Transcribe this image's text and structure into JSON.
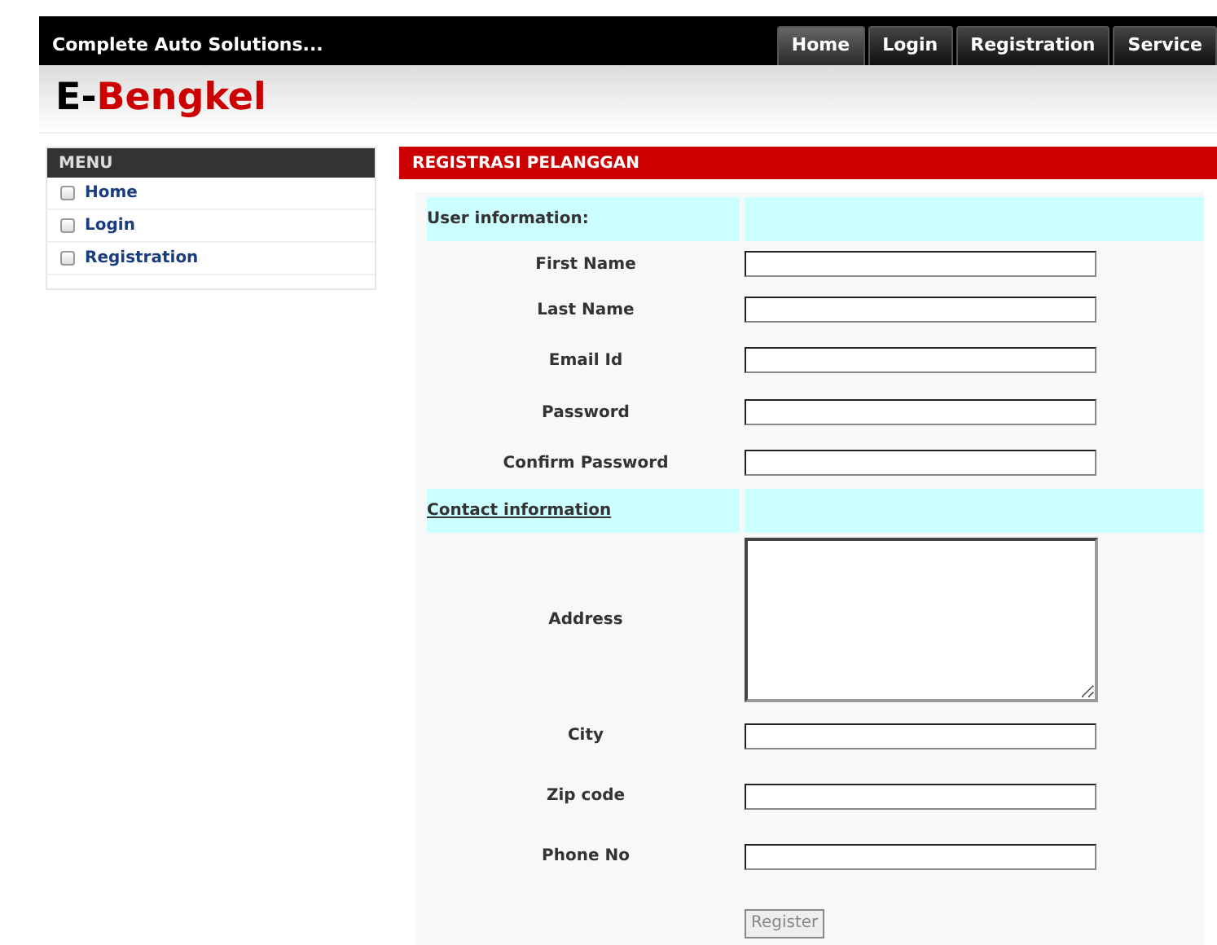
{
  "topbar": {
    "tagline": "Complete Auto Solutions...",
    "tabs": [
      {
        "label": "Home",
        "selected": true
      },
      {
        "label": "Login",
        "selected": false
      },
      {
        "label": "Registration",
        "selected": false
      },
      {
        "label": "Service",
        "selected": false
      }
    ]
  },
  "logo": {
    "prefix": "E-",
    "name": "Bengkel"
  },
  "menu": {
    "title": "MENU",
    "items": [
      "Home",
      "Login",
      "Registration"
    ]
  },
  "form": {
    "title": "REGISTRASI PELANGGAN",
    "sections": [
      {
        "title": "User information:",
        "underlined": false,
        "fields": [
          {
            "label": "First Name",
            "kind": "input"
          },
          {
            "label": "Last Name",
            "kind": "input"
          },
          {
            "label": "Email Id",
            "kind": "input"
          },
          {
            "label": "Password",
            "kind": "input"
          },
          {
            "label": "Confirm Password",
            "kind": "input"
          }
        ]
      },
      {
        "title": "Contact information",
        "underlined": true,
        "fields": [
          {
            "label": "Address",
            "kind": "textarea"
          },
          {
            "label": "City",
            "kind": "input"
          },
          {
            "label": "Zip code",
            "kind": "input"
          },
          {
            "label": "Phone No",
            "kind": "input"
          }
        ]
      }
    ],
    "submit": "Register"
  }
}
